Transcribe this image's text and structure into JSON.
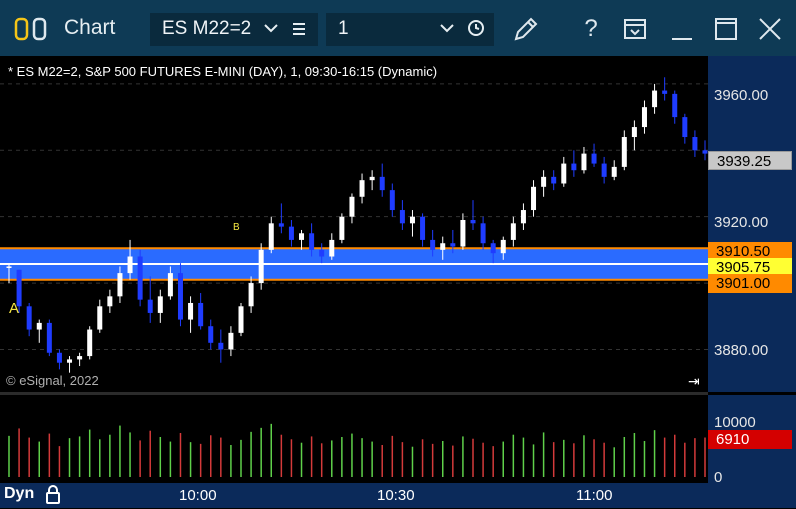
{
  "titlebar": {
    "title": "Chart",
    "symbol": "ES M22=2",
    "interval": "1",
    "icons": [
      "layout-toggle-icon",
      "chevron-down-icon",
      "list-icon",
      "chevron-down-icon",
      "clock-icon",
      "pencil-icon",
      "help-icon",
      "window-save-icon",
      "minimize-icon",
      "maximize-icon",
      "close-icon"
    ]
  },
  "chart": {
    "info": "* ES M22=2, S&P 500 FUTURES E-MINI (DAY), 1, 09:30-16:15 (Dynamic)",
    "copyright": "© eSignal, 2022",
    "marker_a": "A",
    "marker_b": "B",
    "mode": "Dyn",
    "goto_end_symbol": "⇥",
    "colors": {
      "up": "#ffffff",
      "down": "#1f3cff",
      "band": "#2a6bff",
      "band_edge": "#ff8a00",
      "last_price_tag": "#c8c8c8",
      "volume_tag": "#d40000"
    }
  },
  "price_axis": {
    "ticks": [
      "3960.00",
      "3939.25",
      "3920.00",
      "3880.00"
    ],
    "tags": {
      "upper": "3910.50",
      "mid": "3905.75",
      "lower": "3901.00",
      "last": "3939.25"
    }
  },
  "volume_axis": {
    "ticks": [
      "10000",
      "0"
    ],
    "last_volume": "6910"
  },
  "time_axis": {
    "ticks": [
      "10:00",
      "10:30",
      "11:00"
    ]
  },
  "chart_data": {
    "type": "candlestick",
    "ylim": [
      3872,
      3966
    ],
    "band": {
      "upper": 3910.5,
      "mid": 3905.75,
      "lower": 3901.0
    },
    "candles": [
      [
        3905,
        3906,
        3900,
        3905
      ],
      [
        3904,
        3904,
        3891,
        3893
      ],
      [
        3893,
        3894,
        3884,
        3886
      ],
      [
        3886,
        3889,
        3882,
        3888
      ],
      [
        3888,
        3889,
        3878,
        3879
      ],
      [
        3879,
        3880,
        3874,
        3876
      ],
      [
        3876,
        3878,
        3873,
        3877
      ],
      [
        3877,
        3879,
        3875,
        3878
      ],
      [
        3878,
        3887,
        3877,
        3886
      ],
      [
        3886,
        3895,
        3885,
        3893
      ],
      [
        3893,
        3898,
        3891,
        3896
      ],
      [
        3896,
        3905,
        3894,
        3903
      ],
      [
        3903,
        3913,
        3901,
        3908
      ],
      [
        3908,
        3910,
        3893,
        3895
      ],
      [
        3895,
        3902,
        3888,
        3891
      ],
      [
        3891,
        3898,
        3888,
        3896
      ],
      [
        3896,
        3905,
        3895,
        3903
      ],
      [
        3903,
        3906,
        3887,
        3889
      ],
      [
        3889,
        3896,
        3885,
        3894
      ],
      [
        3894,
        3897,
        3886,
        3887
      ],
      [
        3887,
        3889,
        3880,
        3882
      ],
      [
        3882,
        3886,
        3876,
        3880
      ],
      [
        3880,
        3887,
        3878,
        3885
      ],
      [
        3885,
        3894,
        3884,
        3893
      ],
      [
        3893,
        3902,
        3891,
        3900
      ],
      [
        3900,
        3912,
        3898,
        3910
      ],
      [
        3910,
        3920,
        3909,
        3918
      ],
      [
        3918,
        3924,
        3915,
        3917
      ],
      [
        3917,
        3919,
        3911,
        3913
      ],
      [
        3913,
        3916,
        3910,
        3915
      ],
      [
        3915,
        3918,
        3908,
        3910
      ],
      [
        3910,
        3912,
        3906,
        3908
      ],
      [
        3908,
        3915,
        3907,
        3913
      ],
      [
        3913,
        3921,
        3912,
        3920
      ],
      [
        3920,
        3927,
        3918,
        3926
      ],
      [
        3926,
        3933,
        3924,
        3931
      ],
      [
        3931,
        3934,
        3928,
        3932
      ],
      [
        3932,
        3936,
        3926,
        3928
      ],
      [
        3928,
        3930,
        3920,
        3922
      ],
      [
        3922,
        3925,
        3916,
        3918
      ],
      [
        3918,
        3922,
        3914,
        3920
      ],
      [
        3920,
        3921,
        3911,
        3913
      ],
      [
        3913,
        3916,
        3908,
        3910
      ],
      [
        3910,
        3914,
        3907,
        3912
      ],
      [
        3912,
        3916,
        3909,
        3911
      ],
      [
        3911,
        3921,
        3910,
        3919
      ],
      [
        3919,
        3925,
        3916,
        3918
      ],
      [
        3918,
        3920,
        3910,
        3912
      ],
      [
        3912,
        3913,
        3906,
        3909
      ],
      [
        3909,
        3914,
        3907,
        3913
      ],
      [
        3913,
        3920,
        3911,
        3918
      ],
      [
        3918,
        3924,
        3916,
        3922
      ],
      [
        3922,
        3931,
        3920,
        3929
      ],
      [
        3929,
        3934,
        3926,
        3932
      ],
      [
        3932,
        3934,
        3928,
        3930
      ],
      [
        3930,
        3938,
        3929,
        3936
      ],
      [
        3936,
        3940,
        3932,
        3934
      ],
      [
        3934,
        3941,
        3933,
        3939
      ],
      [
        3939,
        3942,
        3935,
        3936
      ],
      [
        3936,
        3938,
        3930,
        3932
      ],
      [
        3932,
        3937,
        3931,
        3935
      ],
      [
        3935,
        3946,
        3934,
        3944
      ],
      [
        3944,
        3949,
        3940,
        3947
      ],
      [
        3947,
        3955,
        3945,
        3953
      ],
      [
        3953,
        3960,
        3951,
        3958
      ],
      [
        3958,
        3962,
        3955,
        3957
      ],
      [
        3957,
        3958,
        3948,
        3950
      ],
      [
        3950,
        3951,
        3942,
        3944
      ],
      [
        3944,
        3946,
        3938,
        3940
      ],
      [
        3940,
        3943,
        3937,
        3939
      ]
    ],
    "volumes": [
      7200,
      8500,
      6900,
      6200,
      7600,
      5400,
      6800,
      7100,
      8300,
      6600,
      7400,
      9000,
      7800,
      6400,
      8100,
      7000,
      6200,
      7700,
      6100,
      5800,
      7300,
      6900,
      5600,
      6500,
      7900,
      8600,
      9300,
      7400,
      6600,
      6000,
      7100,
      5900,
      6400,
      7000,
      7600,
      6800,
      6200,
      5600,
      7200,
      6100,
      5300,
      6600,
      5800,
      6300,
      5500,
      7100,
      6700,
      6000,
      5400,
      6200,
      7400,
      6900,
      5700,
      7800,
      6100,
      6500,
      5900,
      7300,
      6600,
      6000,
      5200,
      7000,
      7700,
      6300,
      8200,
      6900,
      7400,
      6000,
      6800,
      6910
    ],
    "volume_ylim": [
      0,
      14000
    ]
  }
}
